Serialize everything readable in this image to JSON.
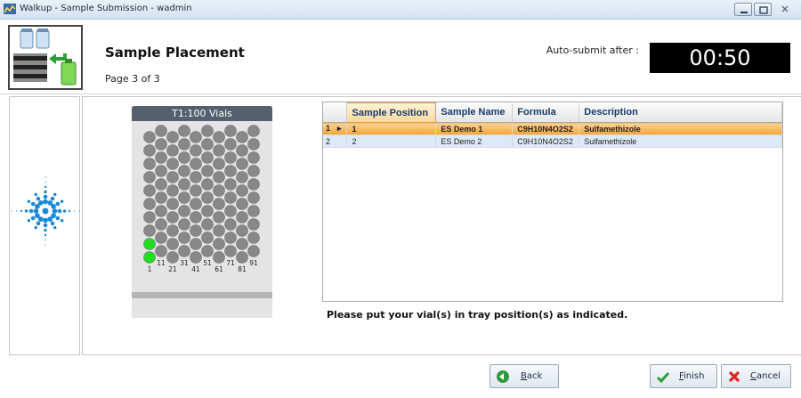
{
  "window": {
    "title": "Walkup - Sample Submission - wadmin"
  },
  "header": {
    "title": "Sample Placement",
    "page_indicator": "Page 3 of 3",
    "auto_submit_label": "Auto-submit after :",
    "countdown": "00:50"
  },
  "tray": {
    "title": "T1:100 Vials",
    "column_labels": [
      "1",
      "11",
      "21",
      "31",
      "41",
      "51",
      "61",
      "71",
      "81",
      "91"
    ],
    "highlighted_positions": [
      1,
      2
    ],
    "colors": {
      "vial": "#888888",
      "highlight": "#22dd22",
      "header": "#54606d"
    }
  },
  "grid": {
    "columns": [
      "Sample Position",
      "Sample Name",
      "Formula",
      "Description"
    ],
    "rows": [
      {
        "index": "1",
        "position": "1",
        "name": "ES Demo 1",
        "formula": "C9H10N4O2S2",
        "description": "Sulfamethizole",
        "selected": true
      },
      {
        "index": "2",
        "position": "2",
        "name": "ES Demo 2",
        "formula": "C9H10N4O2S2",
        "description": "Sulfamethizole",
        "selected": false
      }
    ]
  },
  "instruction": "Please put your vial(s) in tray position(s) as indicated.",
  "buttons": {
    "back": "Back",
    "finish": "Finish",
    "cancel": "Cancel"
  }
}
